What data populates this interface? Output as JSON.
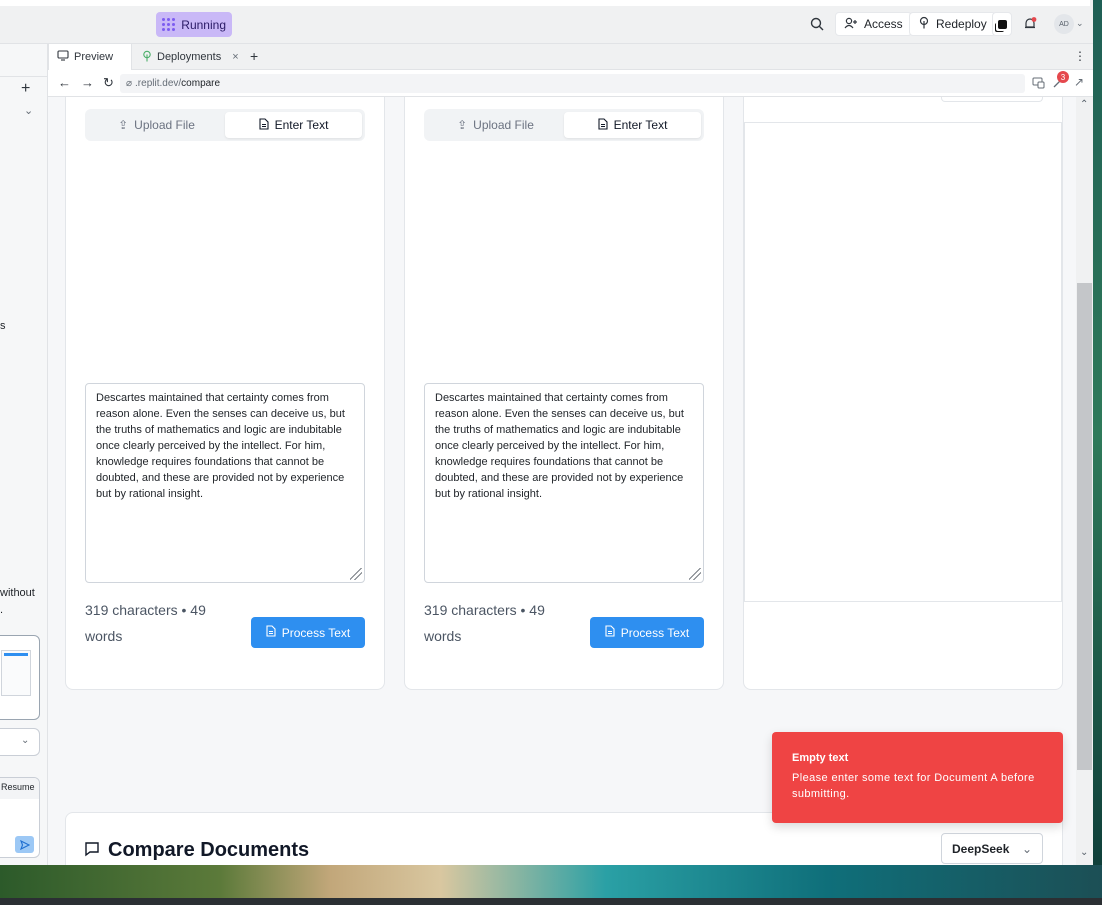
{
  "topbar": {
    "status": "Running",
    "access": "Access",
    "redeploy": "Redeploy",
    "avatar": "AD"
  },
  "tabs": [
    {
      "label": "Preview"
    },
    {
      "label": "Deployments"
    }
  ],
  "url": {
    "prefix": ".replit.dev/",
    "path": "compare",
    "badge": "3"
  },
  "sidebar": {
    "fragment_s": "s",
    "fragment_without": "without",
    "fragment_dot": ".",
    "resume": "Resume"
  },
  "documents": [
    {
      "tab_upload": "Upload File",
      "tab_enter": "Enter Text",
      "text": "Descartes maintained that certainty comes from reason alone. Even the senses can deceive us, but the truths of mathematics and logic are indubitable once clearly perceived by the intellect. For him, knowledge requires foundations that cannot be doubted, and these are provided not by experience but by rational insight.",
      "count_line1": "319   characters   •   49",
      "count_line2": "words",
      "button": "Process Text"
    },
    {
      "tab_upload": "Upload File",
      "tab_enter": "Enter Text",
      "text": "Descartes maintained that certainty comes from reason alone. Even the senses can deceive us, but the truths of mathematics and logic are indubitable once clearly perceived by the intellect. For him, knowledge requires foundations that cannot be doubted, and these are provided not by experience but by rational insight.",
      "count_line1": "319   characters   •   49",
      "count_line2": "words",
      "button": "Process Text"
    }
  ],
  "compare": {
    "title": "Compare Documents",
    "model": "DeepSeek"
  },
  "toast": {
    "title": "Empty text",
    "message": "Please enter some text for Document A before submitting."
  }
}
